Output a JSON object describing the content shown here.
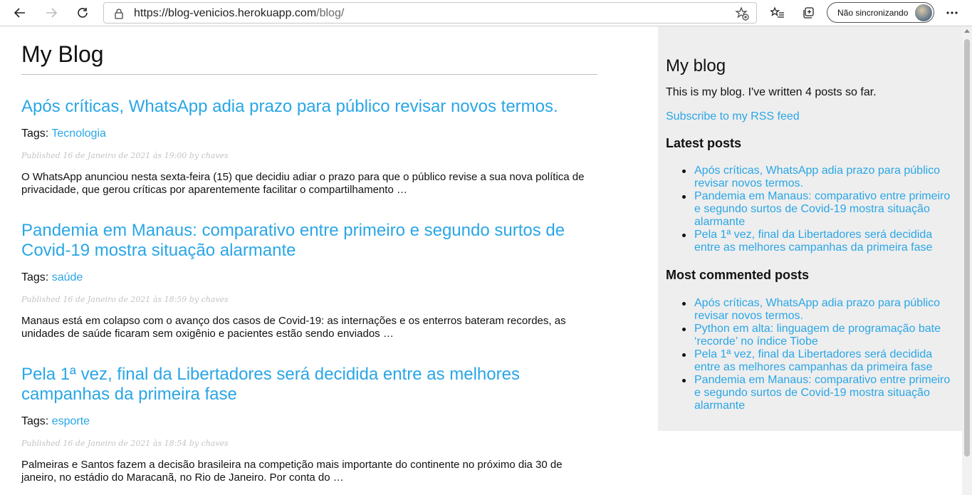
{
  "browser": {
    "url_host": "https://blog-venicios.herokuapp.com",
    "url_path": "/blog/",
    "profile_label": "Não sincronizando"
  },
  "page": {
    "site_title": "My Blog",
    "tags_label": "Tags:",
    "posts": [
      {
        "title": "Após críticas, WhatsApp adia prazo para público revisar novos termos.",
        "tag": "Tecnologia",
        "published": "Published 16 de Janeiro de 2021 às 19:00 by chaves",
        "excerpt": "O WhatsApp anunciou nesta sexta-feira (15) que decidiu adiar o prazo para que o público revise a sua nova política de privacidade, que gerou críticas por aparentemente facilitar o compartilhamento …"
      },
      {
        "title": "Pandemia em Manaus: comparativo entre primeiro e segundo surtos de Covid-19 mostra situação alarmante",
        "tag": "saúde",
        "published": "Published 16 de Janeiro de 2021 às 18:59 by chaves",
        "excerpt": "Manaus está em colapso com o avanço dos casos de Covid-19: as internações e os enterros bateram recordes, as unidades de saúde ficaram sem oxigênio e pacientes estão sendo enviados …"
      },
      {
        "title": "Pela 1ª vez, final da Libertadores será decidida entre as melhores campanhas da primeira fase",
        "tag": "esporte",
        "published": "Published 16 de Janeiro de 2021 às 18:54 by chaves",
        "excerpt": "Palmeiras e Santos fazem a decisão brasileira na competição mais importante do continente no próximo dia 30 de janeiro, no estádio do Maracanã, no Rio de Janeiro. Por conta do …"
      }
    ]
  },
  "sidebar": {
    "title": "My blog",
    "intro": "This is my blog. I've written 4 posts so far.",
    "rss_link": "Subscribe to my RSS feed",
    "latest_heading": "Latest posts",
    "latest": [
      "Após críticas, WhatsApp adia prazo para público revisar novos termos.",
      "Pandemia em Manaus: comparativo entre primeiro e segundo surtos de Covid-19 mostra situação alarmante",
      "Pela 1ª vez, final da Libertadores será decidida entre as melhores campanhas da primeira fase"
    ],
    "commented_heading": "Most commented posts",
    "commented": [
      "Após críticas, WhatsApp adia prazo para público revisar novos termos.",
      "Python em alta: linguagem de programação bate ‘recorde’ no índice Tiobe",
      "Pela 1ª vez, final da Libertadores será decidida entre as melhores campanhas da primeira fase",
      "Pandemia em Manaus: comparativo entre primeiro e segundo surtos de Covid-19 mostra situação alarmante"
    ]
  },
  "colors": {
    "link": "#2aa6e6",
    "sidebar_bg": "#eeeeee",
    "meta_text": "#c4c4c4"
  }
}
